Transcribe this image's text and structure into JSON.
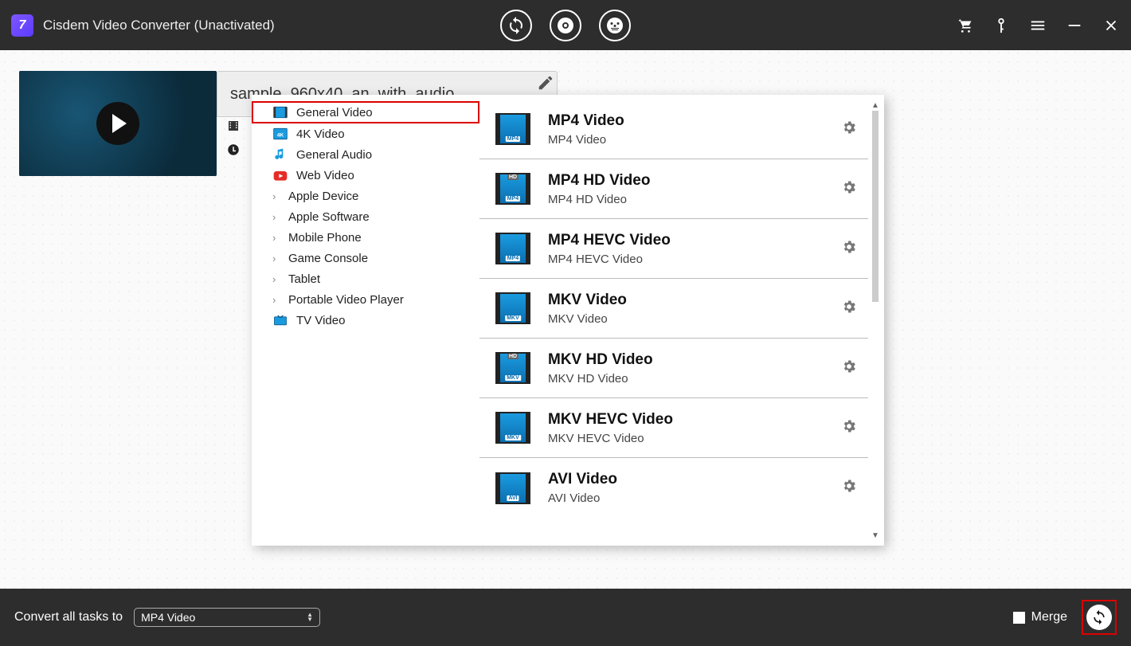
{
  "app": {
    "title": "Cisdem Video Converter (Unactivated)",
    "logo_letter": "7"
  },
  "file": {
    "name": "sample_960x40_an_with_audio"
  },
  "categories": [
    {
      "label": "General Video",
      "icon": "video",
      "active": true,
      "chevron": false
    },
    {
      "label": "4K Video",
      "icon": "4k",
      "active": false,
      "chevron": false
    },
    {
      "label": "General Audio",
      "icon": "audio",
      "active": false,
      "chevron": false
    },
    {
      "label": "Web Video",
      "icon": "youtube",
      "active": false,
      "chevron": false
    },
    {
      "label": "Apple Device",
      "icon": "",
      "active": false,
      "chevron": true
    },
    {
      "label": "Apple Software",
      "icon": "",
      "active": false,
      "chevron": true
    },
    {
      "label": "Mobile Phone",
      "icon": "",
      "active": false,
      "chevron": true
    },
    {
      "label": "Game Console",
      "icon": "",
      "active": false,
      "chevron": true
    },
    {
      "label": "Tablet",
      "icon": "",
      "active": false,
      "chevron": true
    },
    {
      "label": "Portable Video Player",
      "icon": "",
      "active": false,
      "chevron": true
    },
    {
      "label": "TV Video",
      "icon": "tv",
      "active": false,
      "chevron": false
    }
  ],
  "formats": [
    {
      "title": "MP4 Video",
      "sub": "MP4 Video",
      "tag": "MP4",
      "badge": ""
    },
    {
      "title": "MP4 HD Video",
      "sub": "MP4 HD Video",
      "tag": "MP4",
      "badge": "HD"
    },
    {
      "title": "MP4 HEVC Video",
      "sub": "MP4 HEVC Video",
      "tag": "MP4",
      "badge": ""
    },
    {
      "title": "MKV Video",
      "sub": "MKV Video",
      "tag": "MKV",
      "badge": ""
    },
    {
      "title": "MKV HD Video",
      "sub": "MKV HD Video",
      "tag": "MKV",
      "badge": "HD"
    },
    {
      "title": "MKV HEVC Video",
      "sub": "MKV HEVC Video",
      "tag": "MKV",
      "badge": ""
    },
    {
      "title": "AVI Video",
      "sub": "AVI Video",
      "tag": "AVI",
      "badge": ""
    }
  ],
  "bottom": {
    "convert_label": "Convert all tasks to",
    "selected_format": "MP4 Video",
    "merge_label": "Merge"
  }
}
